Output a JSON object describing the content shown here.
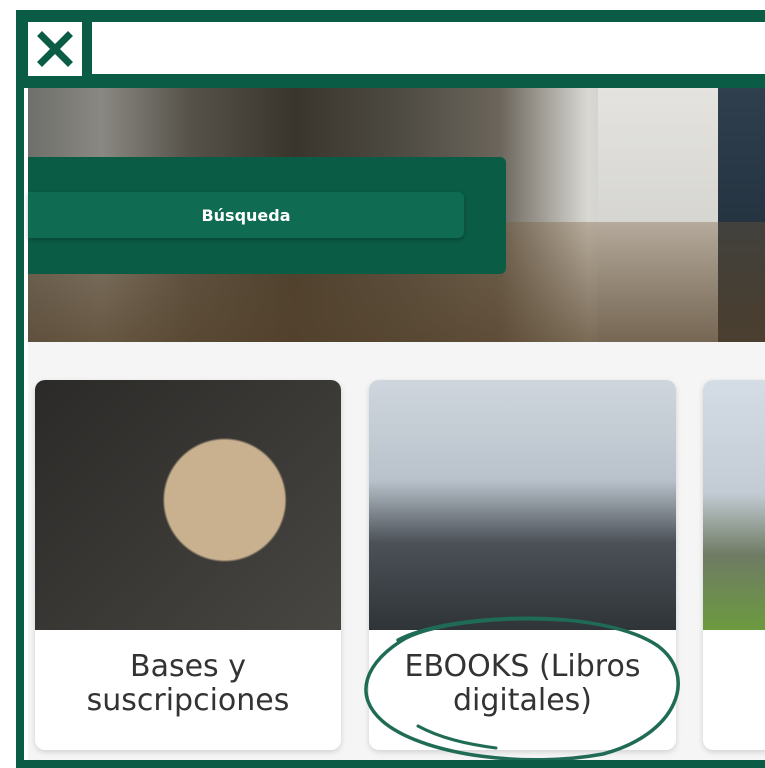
{
  "toolbar": {
    "close_icon": "close-x-icon"
  },
  "hero": {
    "search_label": "Búsqueda"
  },
  "cards": [
    {
      "label_line1": "Bases y",
      "label_line2": "suscripciones"
    },
    {
      "label_line1": "EBOOKS (Libros",
      "label_line2": "digitales)"
    }
  ],
  "colors": {
    "brand_green": "#0b5c45",
    "button_green": "#0f6b52",
    "highlight_circle": "#1f6b55"
  }
}
